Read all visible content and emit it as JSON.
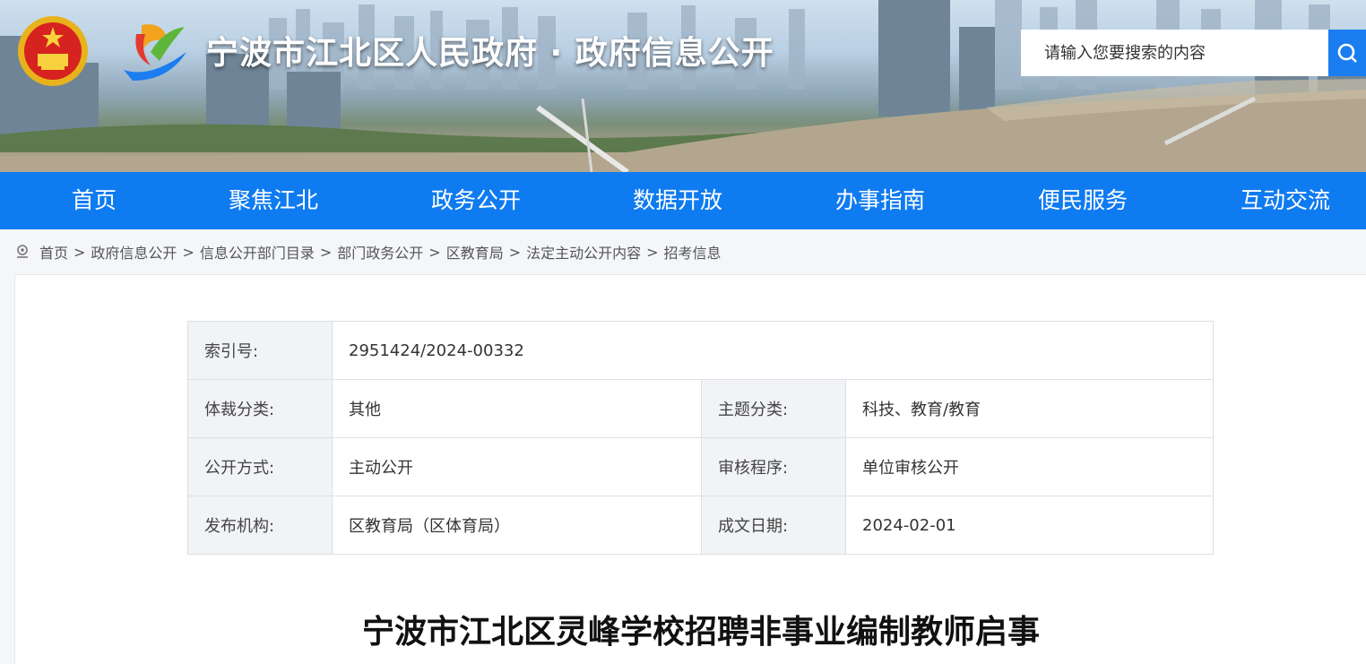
{
  "header": {
    "site_title": "宁波市江北区人民政府 · 政府信息公开",
    "search_placeholder": "请输入您要搜索的内容"
  },
  "nav": {
    "items": [
      "首页",
      "聚焦江北",
      "政务公开",
      "数据开放",
      "办事指南",
      "便民服务",
      "互动交流"
    ]
  },
  "breadcrumb": {
    "items": [
      "首页",
      "政府信息公开",
      "信息公开部门目录",
      "部门政务公开",
      "区教育局",
      "法定主动公开内容",
      "招考信息"
    ],
    "separator": ">"
  },
  "info": {
    "index_label": "索引号:",
    "index_value": "2951424/2024-00332",
    "genre_label": "体裁分类:",
    "genre_value": "其他",
    "topic_label": "主题分类:",
    "topic_value": "科技、教育/教育",
    "method_label": "公开方式:",
    "method_value": "主动公开",
    "review_label": "审核程序:",
    "review_value": "单位审核公开",
    "org_label": "发布机构:",
    "org_value": "区教育局（区体育局）",
    "date_label": "成文日期:",
    "date_value": "2024-02-01"
  },
  "document": {
    "title": "宁波市江北区灵峰学校招聘非事业编制教师启事"
  },
  "colors": {
    "nav_blue": "#0f7bf0",
    "search_blue": "#1a7df0"
  }
}
